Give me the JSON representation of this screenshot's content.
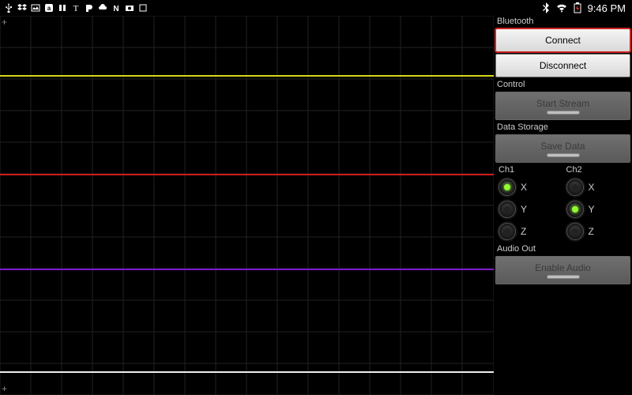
{
  "statusbar": {
    "icons": [
      "usb",
      "dropbox",
      "gallery",
      "amazon",
      "book",
      "nyt",
      "play",
      "cloud",
      "netflix",
      "camera",
      "box"
    ],
    "bluetooth": "bt",
    "wifi": "wifi",
    "battery": "batt",
    "time": "9:46 PM"
  },
  "panel": {
    "bluetooth_label": "Bluetooth",
    "connect_label": "Connect",
    "disconnect_label": "Disconnect",
    "control_label": "Control",
    "start_stream_label": "Start Stream",
    "data_storage_label": "Data Storage",
    "save_data_label": "Save Data",
    "ch1_label": "Ch1",
    "ch2_label": "Ch2",
    "x_label": "X",
    "y_label": "Y",
    "z_label": "Z",
    "ch1_selected": "X",
    "ch2_selected": "Y",
    "audio_out_label": "Audio Out",
    "enable_audio_label": "Enable Audio"
  },
  "chart_data": {
    "type": "line",
    "title": "",
    "xlabel": "",
    "ylabel": "",
    "ylim": [
      0,
      480
    ],
    "grid": true,
    "series": [
      {
        "name": "yellow",
        "color": "#d6d61a",
        "y": 75
      },
      {
        "name": "red",
        "color": "#cc1a1a",
        "y": 200
      },
      {
        "name": "purple",
        "color": "#7a1acc",
        "y": 320
      },
      {
        "name": "white",
        "color": "#eeeeee",
        "y": 450
      }
    ]
  }
}
